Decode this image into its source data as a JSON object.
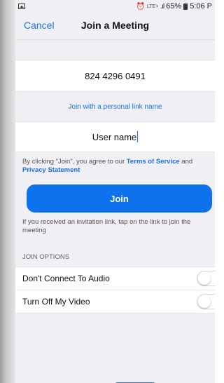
{
  "status_bar": {
    "left_icon": "image-icon",
    "lte": "LTE+",
    "battery_percent": "65%",
    "time": "5:06 P"
  },
  "nav": {
    "cancel_label": "Cancel",
    "title": "Join a Meeting"
  },
  "meeting_id": {
    "value": "824 4296 0491"
  },
  "personal_link": {
    "label": "Join with a personal link name"
  },
  "username": {
    "value": "User name"
  },
  "terms": {
    "prefix": "By clicking \"Join\", you agree to our ",
    "terms_link": "Terms of Service",
    "and": " and ",
    "privacy_link": "Privacy Statement"
  },
  "join_button": {
    "label": "Join"
  },
  "invite_hint": {
    "text": "If you received an invitation link, tap on the link to join the meeting"
  },
  "join_options": {
    "header": "JOIN OPTIONS",
    "items": [
      {
        "label": "Don't Connect To Audio",
        "enabled": false
      },
      {
        "label": "Turn Off My Video",
        "enabled": false
      }
    ]
  },
  "colors": {
    "accent": "#1a73e8",
    "join_button": "#0e72ed",
    "background": "#efeff4"
  }
}
